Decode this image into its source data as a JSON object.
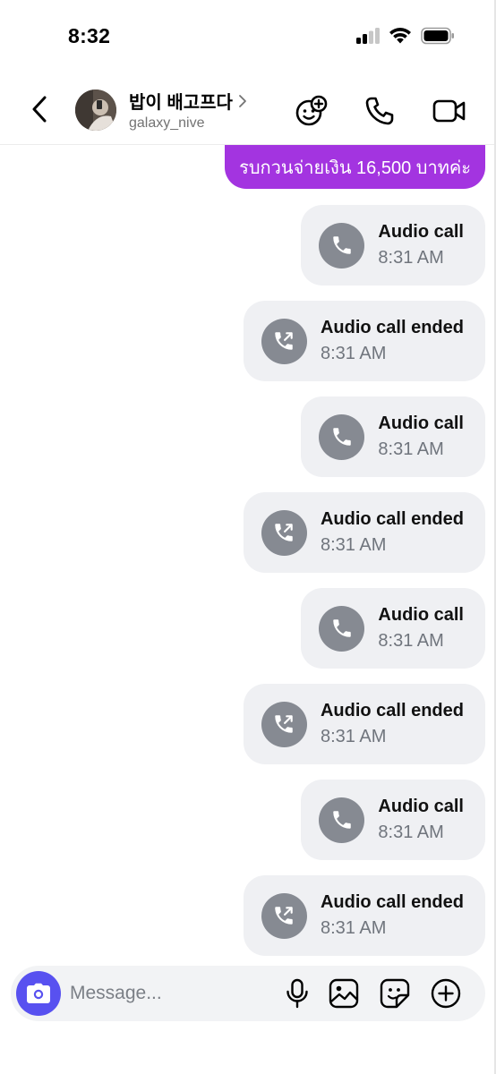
{
  "status_bar": {
    "time": "8:32",
    "icons": [
      "cellular-signal-icon",
      "wifi-icon",
      "battery-icon"
    ]
  },
  "header": {
    "contact_name": "밥이 배고프다",
    "username": "galaxy_nive",
    "icons": [
      "back-chevron-icon",
      "chevron-right-icon",
      "add-emoji-icon",
      "phone-icon",
      "video-camera-icon"
    ]
  },
  "thread": {
    "text_message": "รบกวนจ่ายเงิน 16,500 บาทค่ะ",
    "text_message_color": "#a334e0",
    "calls": [
      {
        "title": "Audio call",
        "time": "8:31 AM",
        "icon": "phone-icon"
      },
      {
        "title": "Audio call ended",
        "time": "8:31 AM",
        "icon": "phone-outgoing-icon"
      },
      {
        "title": "Audio call",
        "time": "8:31 AM",
        "icon": "phone-icon"
      },
      {
        "title": "Audio call ended",
        "time": "8:31 AM",
        "icon": "phone-outgoing-icon"
      },
      {
        "title": "Audio call",
        "time": "8:31 AM",
        "icon": "phone-icon"
      },
      {
        "title": "Audio call ended",
        "time": "8:31 AM",
        "icon": "phone-outgoing-icon"
      },
      {
        "title": "Audio call",
        "time": "8:31 AM",
        "icon": "phone-icon"
      },
      {
        "title": "Audio call ended",
        "time": "8:31 AM",
        "icon": "phone-outgoing-icon"
      }
    ]
  },
  "composer": {
    "placeholder": "Message...",
    "value": "",
    "accent_color": "#5851f0",
    "icons": [
      "camera-icon",
      "microphone-icon",
      "image-icon",
      "sticker-icon",
      "plus-circle-icon"
    ]
  }
}
